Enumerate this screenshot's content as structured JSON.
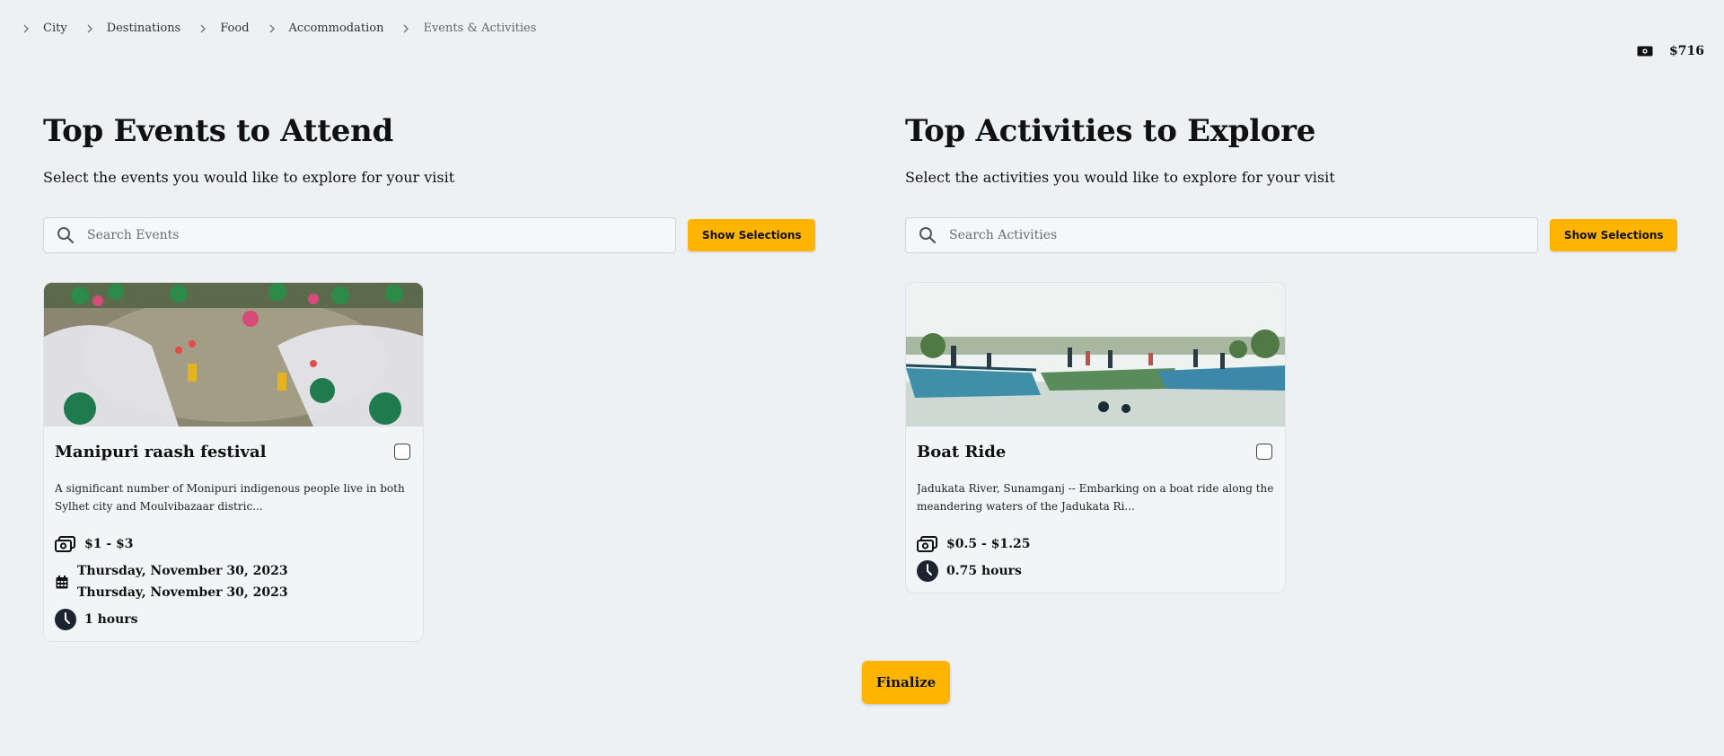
{
  "breadcrumb": {
    "items": [
      {
        "label": "City"
      },
      {
        "label": "Destinations"
      },
      {
        "label": "Food"
      },
      {
        "label": "Accommodation"
      },
      {
        "label": "Events & Activities"
      }
    ]
  },
  "budget": {
    "value": "$716",
    "icon": "money-icon"
  },
  "events": {
    "heading": "Top Events to Attend",
    "subheading": "Select the events you would like to explore for your visit",
    "search_placeholder": "Search Events",
    "show_selections_label": "Show Selections",
    "cards": [
      {
        "title": "Manipuri raash festival",
        "description": "A significant number of Monipuri indigenous people live in both Sylhet city and Moulvibazaar distric...",
        "price": "$1 - $3",
        "date_start": "Thursday, November 30, 2023",
        "date_end": "Thursday, November 30, 2023",
        "duration": "1 hours",
        "checked": false
      }
    ]
  },
  "activities": {
    "heading": "Top Activities to Explore",
    "subheading": "Select the activities you would like to explore for your visit",
    "search_placeholder": "Search Activities",
    "show_selections_label": "Show Selections",
    "cards": [
      {
        "title": "Boat Ride",
        "description": "Jadukata River, Sunamganj -- Embarking on a boat ride along the meandering waters of the Jadukata Ri...",
        "price": "$0.5 - $1.25",
        "duration": "0.75 hours",
        "checked": false
      }
    ]
  },
  "finalize_label": "Finalize",
  "colors": {
    "accent": "#ffb400",
    "background": "#edf1f3"
  }
}
